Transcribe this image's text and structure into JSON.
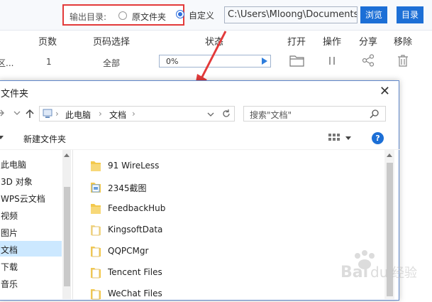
{
  "output_dir": {
    "label": "输出目录:",
    "option_original": "原文件夹",
    "option_custom": "自定义",
    "path": "C:\\Users\\Mloong\\Documents",
    "browse": "浏览",
    "dir": "目录"
  },
  "table": {
    "headers": [
      "页数",
      "页码选择",
      "状态",
      "打开",
      "操作",
      "分享",
      "移除"
    ],
    "row": {
      "name_fragment": "区...",
      "pages": "1",
      "page_sel": "全部",
      "progress": "0%",
      "progress_value": 0
    }
  },
  "dialog": {
    "title": "文件夹",
    "address": [
      "此电脑",
      "文档"
    ],
    "search_placeholder": "搜索\"文档\"",
    "new_folder": "新建文件夹",
    "help": "?",
    "nav_items": [
      "此电脑",
      "3D 对象",
      "WPS云文档",
      "视频",
      "图片",
      "文档",
      "下载",
      "音乐"
    ],
    "selected_nav": "文档",
    "files": [
      "91 WireLess",
      "2345截图",
      "FeedbackHub",
      "KingsoftData",
      "QQPCMgr",
      "Tencent Files",
      "WeChat Files"
    ]
  },
  "watermark": "Baidu 经验",
  "colors": {
    "accent": "#1c6fd6",
    "highlight": "#e33a3a",
    "folder": "#f3c94d"
  }
}
